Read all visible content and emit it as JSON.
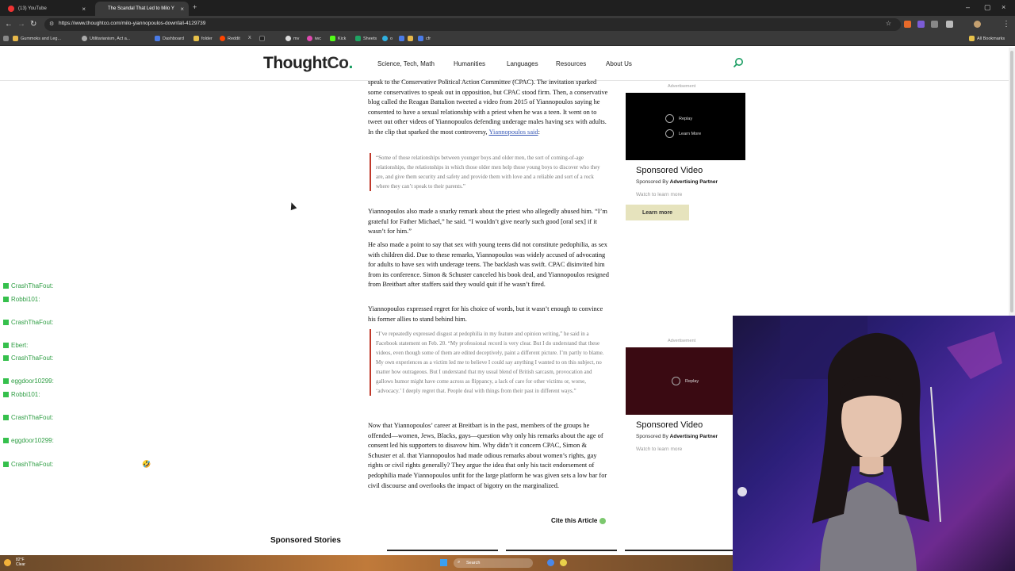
{
  "browser": {
    "tabs": [
      {
        "label": "(13) YouTube"
      },
      {
        "label": "The Scandal That Led to Milo Y"
      }
    ],
    "url": "https://www.thoughtco.com/milo-yiannopoulos-downfall-4129739",
    "bookmarks": [
      "Gummoks and Leg...",
      "Utilitarianism, Act a...",
      "Dashboard",
      "folder",
      "Reddit",
      "X",
      "mv",
      "iwc",
      "Kick",
      "Sheets",
      "o",
      "cfr"
    ],
    "all_bookmarks": "All Bookmarks"
  },
  "site": {
    "logo_main": "Thought",
    "logo_co": "Co",
    "logo_dot": ".",
    "nav": [
      "Science, Tech, Math",
      "Humanities",
      "Languages",
      "Resources",
      "About Us"
    ]
  },
  "article": {
    "p1": "speak to the Conservative Political Action Committee (CPAC). The invitation sparked some conservatives to speak out in opposition, but CPAC stood firm. Then, a conservative blog called the Reagan Battalion tweeted a video from 2015 of Yiannopoulos saying he consented to have a sexual relationship with a priest when he was a teen. It went on to tweet out other videos of Yiannopoulos defending underage males having sex with adults. In the clip that sparked the most controversy,",
    "p1_link": "Yiannopoulos said",
    "p1_end": ":",
    "q1": "“Some of those relationships between younger boys and older men, the sort of coming-of-age relationships, the relationships in which those older men help those young boys to discover who they are, and give them security and safety and provide them with love and a reliable and sort of a rock where they can’t speak to their parents.”",
    "p2": "Yiannopoulos also made a snarky remark about the priest who allegedly abused him. “I’m grateful for Father Michael,” he said. “I wouldn’t give nearly such good [oral sex] if it wasn’t for him.”",
    "p3": "He also made a point to say that sex with young teens did not constitute pedophilia, as sex with children did. Due to these remarks, Yiannopoulos was widely accused of advocating for adults to have sex with underage teens. The backlash was swift. CPAC disinvited him from its conference. Simon & Schuster canceled his book deal, and Yiannopoulos resigned from Breitbart after staffers said they would quit if he wasn’t fired.",
    "p4": "Yiannopoulos expressed regret for his choice of words, but it wasn’t enough to convince his former allies to stand behind him.",
    "q2": "“I’ve repeatedly expressed disgust at pedophilia in my feature and opinion writing,” he said in a Facebook statement on Feb. 20. “My professional record is very clear. But I do understand that these videos, even though some of them are edited deceptively, paint a different picture. I’m partly to blame. My own experiences as a victim led me to believe I could say anything I wanted to on this subject, no matter how outrageous. But I understand that my usual blend of British sarcasm, provocation and gallows humor might have come across as flippancy, a lack of care for other victims or, worse, ‘advocacy.’ I deeply regret that. People deal with things from their past in different ways.”",
    "p5": "Now that Yiannopoulos’ career at Breitbart is in the past, members of the groups he offended—women, Jews, Blacks, gays—question why only his remarks about the age of consent led his supporters to disavow him. Why didn’t it concern CPAC, Simon & Schuster et al. that Yiannopoulos had made odious remarks about women’s rights, gay rights or civil rights generally? They argue the idea that only his tacit endorsement of pedophilia made Yiannopoulos unfit for the large platform he was given sets a low bar for civil discourse and overlooks the impact of bigotry on the marginalized.",
    "cite": "Cite this Article",
    "sponsored_stories": "Sponsored Stories"
  },
  "ads": {
    "label": "Advertisement",
    "replay": "Replay",
    "learn_more_small": "Learn More",
    "title": "Sponsored Video",
    "by": "Sponsored By",
    "partner": "Advertising Partner",
    "watch": "Watch to learn more",
    "learn_more_btn": "Learn more"
  },
  "chat": [
    {
      "user": "CrashThaFout:"
    },
    {
      "user": "Robbi101:"
    },
    {
      "user": "CrashThaFout:"
    },
    {
      "user": "Ebert:"
    },
    {
      "user": "CrashThaFout:"
    },
    {
      "user": "eggdoor10299:"
    },
    {
      "user": "Robbi101:"
    },
    {
      "user": "CrashThaFout:"
    },
    {
      "user": "eggdoor10299:"
    },
    {
      "user": "CrashThaFout:"
    }
  ],
  "taskbar": {
    "temp": "82°F",
    "condition": "Clear",
    "search": "Search"
  }
}
